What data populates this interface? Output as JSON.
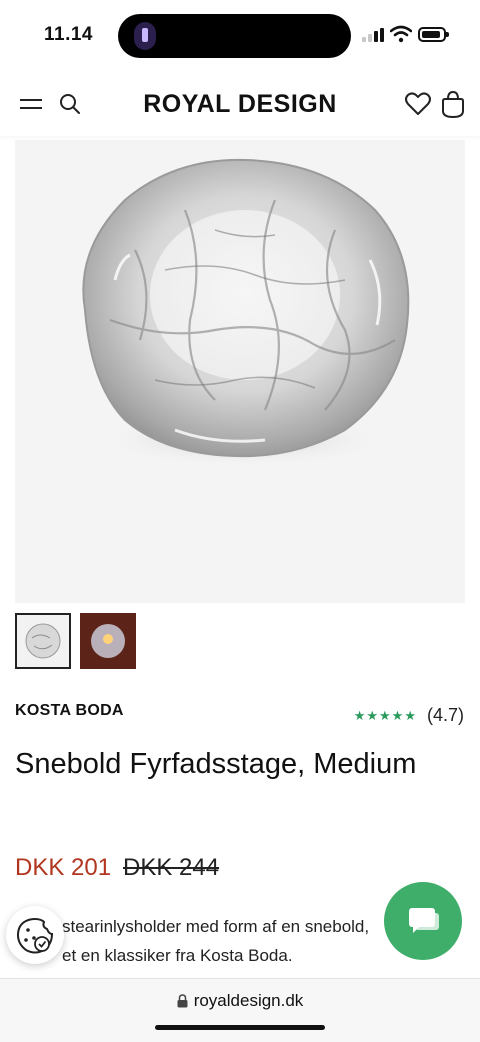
{
  "status_bar": {
    "time": "11.14"
  },
  "header": {
    "logo": "ROYAL DESIGN"
  },
  "product": {
    "brand": "KOSTA BODA",
    "rating_stars": "★★★★★",
    "rating_value": "(4.7)",
    "rating": 4.7,
    "title": "Snebold Fyrfadsstage, Medium",
    "price": "DKK 201",
    "old_price": "DKK 244",
    "description_line1": "stearinlysholder med form af en snebold,",
    "description_line2": "et en klassiker fra Kosta Boda."
  },
  "browser": {
    "url": "royaldesign.dk"
  },
  "colors": {
    "price": "#b2361f",
    "stars": "#2c9a5d",
    "chat": "#3fae6a"
  },
  "icons": [
    "menu-icon",
    "search-icon",
    "heart-icon",
    "bag-icon",
    "cookie-icon",
    "chat-icon",
    "lock-icon"
  ]
}
